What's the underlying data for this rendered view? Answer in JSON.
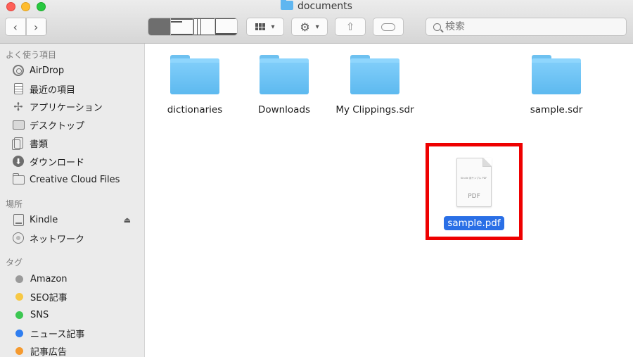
{
  "window": {
    "title": "documents"
  },
  "toolbar": {
    "back_icon": "chevron-left",
    "forward_icon": "chevron-right",
    "view_modes": [
      "icon",
      "list",
      "column",
      "gallery"
    ],
    "active_view": "icon",
    "search_placeholder": "検索"
  },
  "sidebar": {
    "favorites_header": "よく使う項目",
    "favorites": [
      {
        "label": "AirDrop",
        "icon": "airdrop-icon"
      },
      {
        "label": "最近の項目",
        "icon": "recents-icon"
      },
      {
        "label": "アプリケーション",
        "icon": "applications-icon"
      },
      {
        "label": "デスクトップ",
        "icon": "desktop-icon"
      },
      {
        "label": "書類",
        "icon": "documents-icon"
      },
      {
        "label": "ダウンロード",
        "icon": "downloads-icon"
      },
      {
        "label": "Creative Cloud Files",
        "icon": "folder-icon"
      }
    ],
    "locations_header": "場所",
    "locations": [
      {
        "label": "Kindle",
        "icon": "drive-icon",
        "eject": true
      },
      {
        "label": "ネットワーク",
        "icon": "network-icon"
      }
    ],
    "tags_header": "タグ",
    "tags": [
      {
        "label": "Amazon",
        "color": "#9a9a9a"
      },
      {
        "label": "SEO記事",
        "color": "#f7c844"
      },
      {
        "label": "SNS",
        "color": "#3cc752"
      },
      {
        "label": "ニュース記事",
        "color": "#2f7ef0"
      },
      {
        "label": "記事広告",
        "color": "#f59a2f"
      }
    ]
  },
  "files": [
    {
      "name": "dictionaries",
      "kind": "folder"
    },
    {
      "name": "Downloads",
      "kind": "folder"
    },
    {
      "name": "My Clippings.sdr",
      "kind": "folder"
    },
    {
      "name": "sample.sdr",
      "kind": "folder"
    },
    {
      "name": "sample.pdf",
      "kind": "pdf",
      "selected": true,
      "preview_text": "Kindle 用サンプル PDF",
      "type_label": "PDF"
    }
  ],
  "annotation": {
    "highlight_color": "#ee0000",
    "target": "sample.pdf"
  }
}
